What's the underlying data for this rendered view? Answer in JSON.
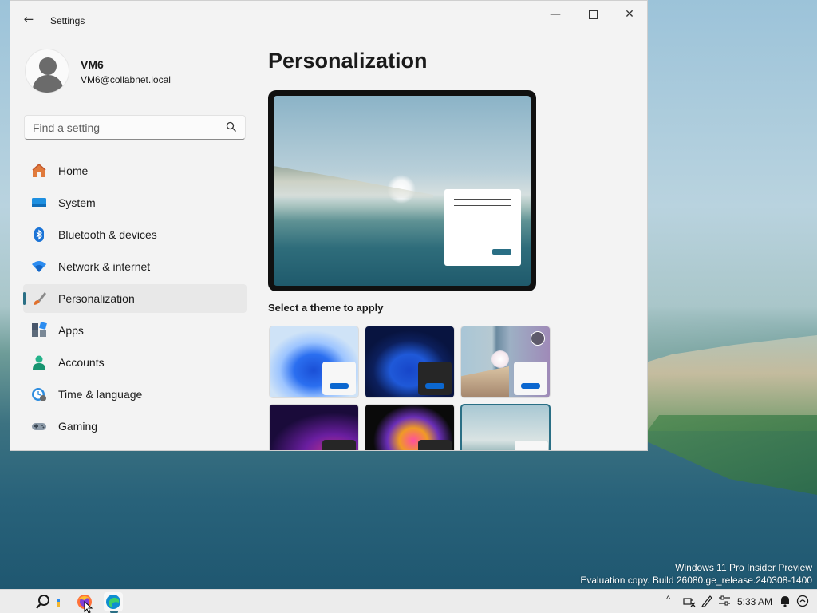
{
  "window": {
    "app_title": "Settings",
    "back_glyph": "←",
    "minimize_glyph": "—",
    "close_glyph": "✕"
  },
  "profile": {
    "name": "VM6",
    "email": "VM6@collabnet.local"
  },
  "search": {
    "placeholder": "Find a setting"
  },
  "nav": {
    "items": [
      {
        "label": "Home",
        "icon": "home-icon"
      },
      {
        "label": "System",
        "icon": "system-icon"
      },
      {
        "label": "Bluetooth & devices",
        "icon": "bluetooth-icon"
      },
      {
        "label": "Network & internet",
        "icon": "network-icon"
      },
      {
        "label": "Personalization",
        "icon": "brush-icon",
        "selected": true
      },
      {
        "label": "Apps",
        "icon": "apps-icon"
      },
      {
        "label": "Accounts",
        "icon": "accounts-icon"
      },
      {
        "label": "Time & language",
        "icon": "time-language-icon"
      },
      {
        "label": "Gaming",
        "icon": "gaming-icon"
      }
    ]
  },
  "main": {
    "title": "Personalization",
    "themes_label": "Select a theme to apply",
    "themes": [
      {
        "name": "windows-light",
        "selected": false
      },
      {
        "name": "windows-dark",
        "selected": false
      },
      {
        "name": "windows-spotlight",
        "selected": false
      },
      {
        "name": "glow",
        "selected": false
      },
      {
        "name": "captured-motion",
        "selected": false
      },
      {
        "name": "flow",
        "selected": true
      }
    ]
  },
  "watermark": {
    "line1": "Windows 11 Pro Insider Preview",
    "line2": "Evaluation copy. Build 26080.ge_release.240308-1400"
  },
  "taskbar": {
    "time": "5:33 AM",
    "chevron": "^"
  },
  "colors": {
    "accent": "#2a6f85",
    "theme_button": "#0b67d0"
  }
}
